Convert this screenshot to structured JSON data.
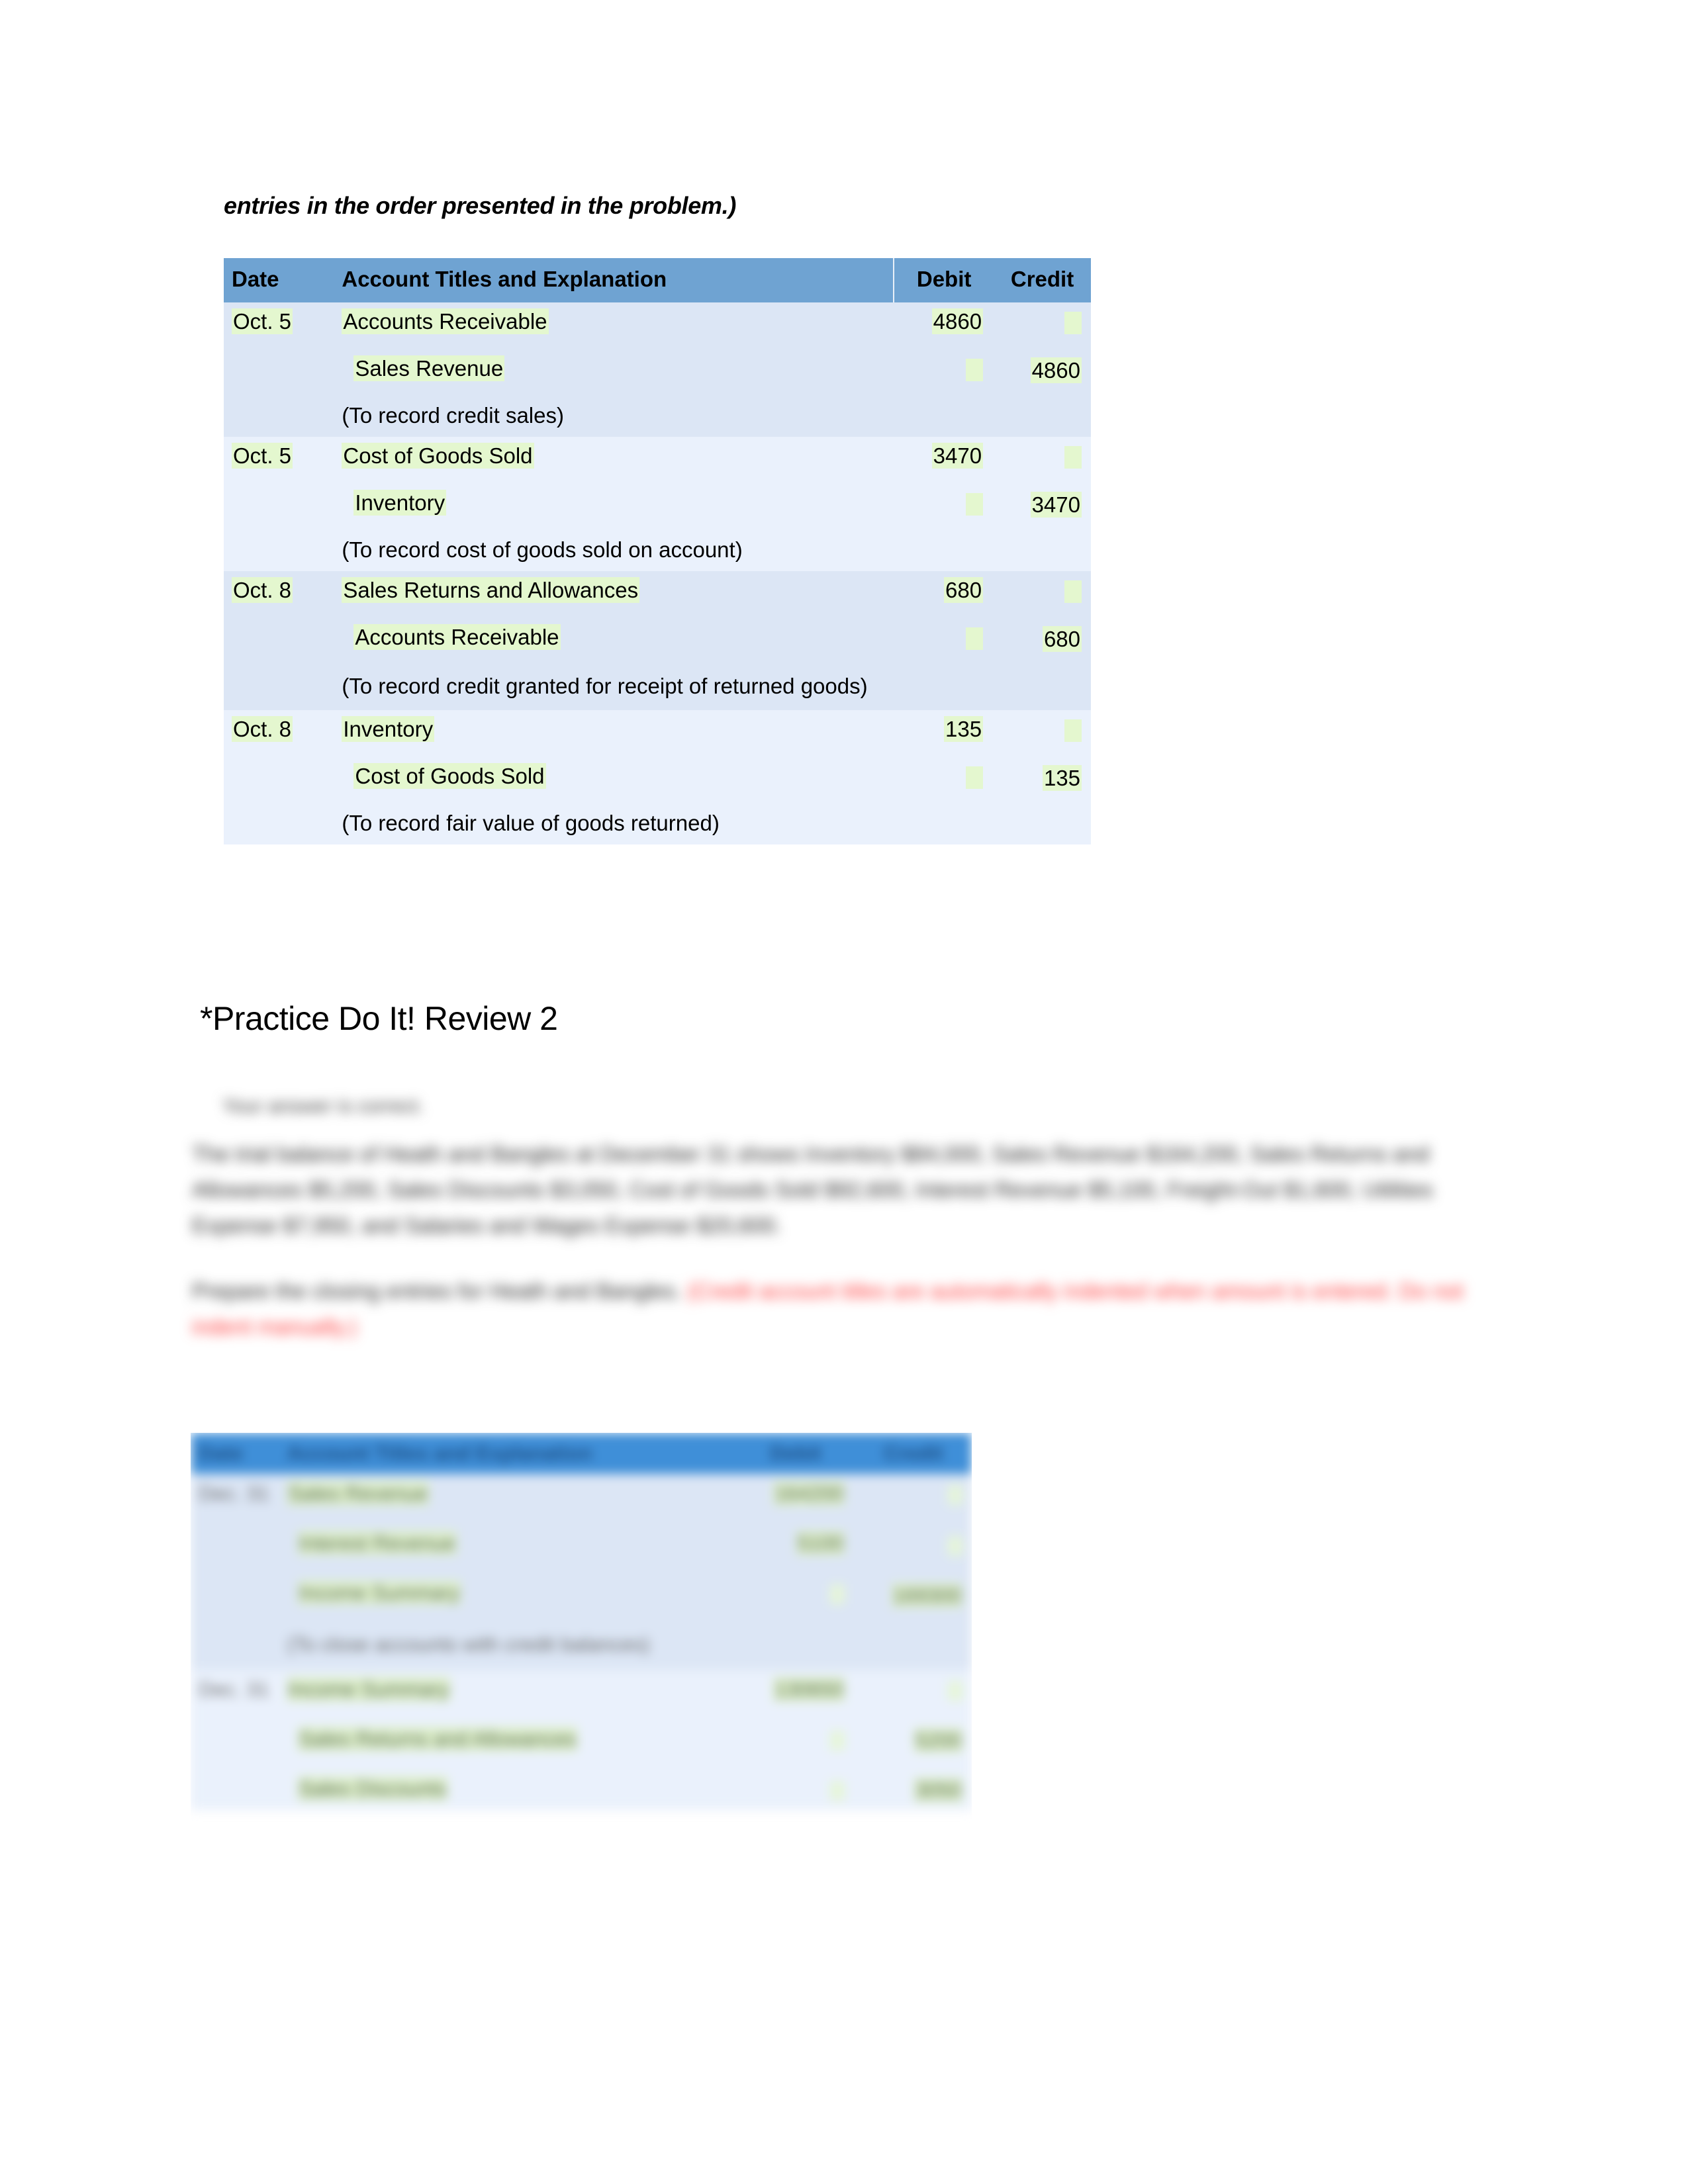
{
  "document": {
    "intro_line": "entries in the order presented in the problem.)",
    "section_heading": "*Practice Do It! Review 2"
  },
  "journal_table": {
    "headers": {
      "date": "Date",
      "account": "Account Titles and Explanation",
      "debit": "Debit",
      "credit": "Credit"
    },
    "entries": [
      {
        "date": "Oct. 5",
        "debit_account": "Accounts Receivable",
        "debit_amount": "4860",
        "credit_account": "Sales Revenue",
        "credit_amount": "4860",
        "explanation": "(To record credit sales)"
      },
      {
        "date": "Oct. 5",
        "debit_account": "Cost of Goods Sold",
        "debit_amount": "3470",
        "credit_account": "Inventory",
        "credit_amount": "3470",
        "explanation": "(To record cost of goods sold on account)"
      },
      {
        "date": "Oct. 8",
        "debit_account": "Sales Returns and Allowances",
        "debit_amount": "680",
        "credit_account": "Accounts Receivable",
        "credit_amount": "680",
        "explanation": "(To record credit granted for receipt of returned goods)"
      },
      {
        "date": "Oct. 8",
        "debit_account": "Inventory",
        "debit_amount": "135",
        "credit_account": "Cost of Goods Sold",
        "credit_amount": "135",
        "explanation": "(To record fair value of goods returned)"
      }
    ]
  },
  "blurred_section": {
    "hint_label": "Your answer is correct.",
    "paragraph_1": "The trial balance of Heath and Bangles at December 31 shows Inventory $84,000, Sales Revenue $164,200, Sales Returns and Allowances $5,200, Sales Discounts $3,050, Cost of Goods Sold $92,600, Interest Revenue $5,100, Freight-Out $1,600, Utilities Expense $7,950, and Salaries and Wages Expense $20,600.",
    "paragraph_2_black": "Prepare the closing entries for Heath and Bangles.",
    "paragraph_2_red": "(Credit account titles are automatically indented when amount is entered. Do not indent manually.)"
  },
  "journal_table_2": {
    "headers": {
      "date": "Date",
      "account": "Account Titles and Explanation",
      "debit": "Debit",
      "credit": "Credit"
    },
    "entries": [
      {
        "date": "Dec. 31",
        "lines": [
          {
            "account": "Sales Revenue",
            "debit": "164200",
            "credit": ""
          },
          {
            "account": "Interest Revenue",
            "debit": "5100",
            "credit": ""
          },
          {
            "account": "Income Summary",
            "debit": "",
            "credit": "169300"
          }
        ],
        "explanation": "(To close accounts with credit balances)"
      },
      {
        "date": "Dec. 31",
        "lines": [
          {
            "account": "Income Summary",
            "debit": "130650",
            "credit": ""
          },
          {
            "account": "Sales Returns and Allowances",
            "debit": "",
            "credit": "5200"
          },
          {
            "account": "Sales Discounts",
            "debit": "",
            "credit": "3050"
          }
        ],
        "explanation": ""
      }
    ]
  },
  "colors": {
    "header_blue": "#6fa3d2",
    "header_blue_2": "#3f8fd8",
    "row_dark": "#dce6f5",
    "row_light": "#eaf1fc",
    "highlight_green": "#e4f7cf",
    "red_text": "#ff3a3a"
  }
}
